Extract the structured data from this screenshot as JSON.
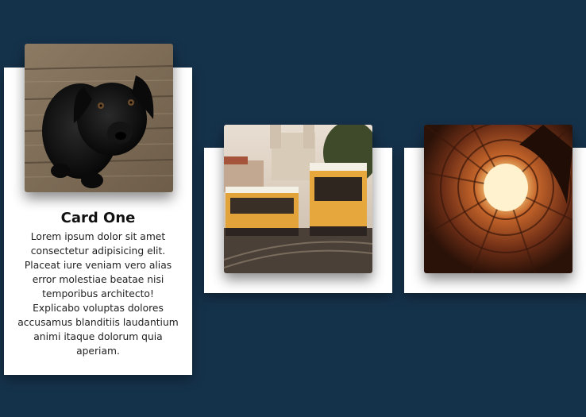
{
  "cards": [
    {
      "title": "Card One",
      "body": "Lorem ipsum dolor sit amet consectetur adipisicing elit. Placeat iure veniam vero alias error molestiae beatae nisi temporibus architecto! Explicabo voluptas dolores accusamus blanditiis laudantium animi itaque dolorum quia aperiam.",
      "image": "black-puppy-photo"
    },
    {
      "image": "yellow-tram-photo"
    },
    {
      "image": "courtyard-sky-photo"
    }
  ],
  "colors": {
    "background": "#15324b",
    "card": "#ffffff",
    "title": "#111111",
    "text": "#222222"
  }
}
